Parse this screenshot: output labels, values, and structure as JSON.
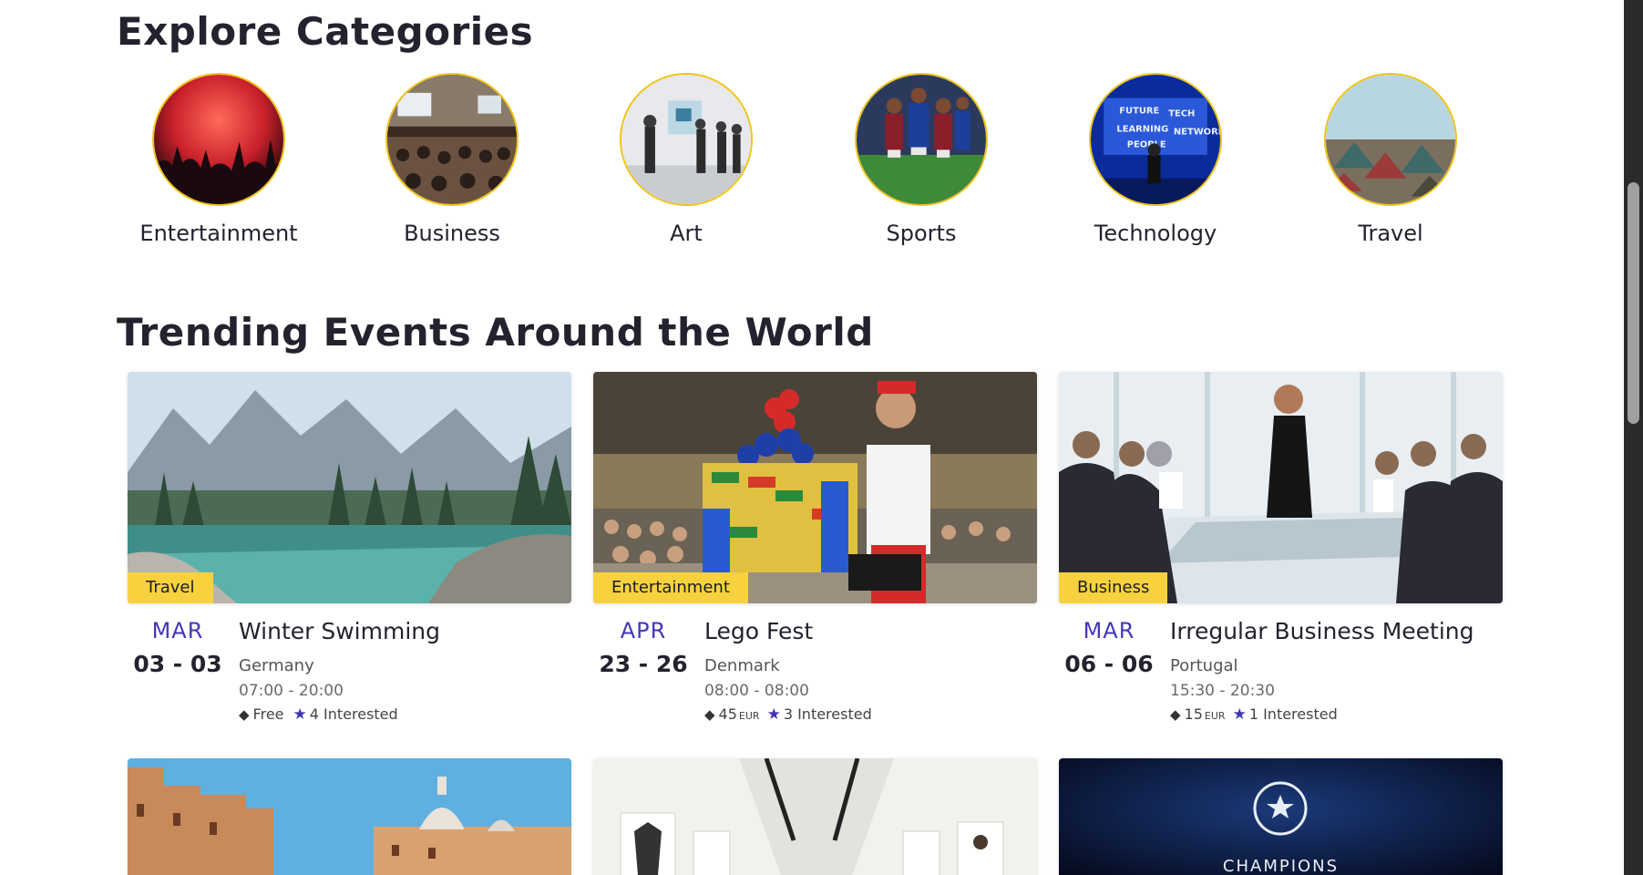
{
  "sections": {
    "categories_title": "Explore Categories",
    "trending_title": "Trending Events Around the World"
  },
  "categories": [
    {
      "label": "Entertainment",
      "icon": "concert-crowd-image"
    },
    {
      "label": "Business",
      "icon": "conference-room-image"
    },
    {
      "label": "Art",
      "icon": "art-gallery-image"
    },
    {
      "label": "Sports",
      "icon": "football-players-image"
    },
    {
      "label": "Technology",
      "icon": "tech-speaker-image"
    },
    {
      "label": "Travel",
      "icon": "camping-tents-image"
    }
  ],
  "events": [
    {
      "category": "Travel",
      "month": "MAR",
      "days": "03 - 03",
      "title": "Winter Swimming",
      "location": "Germany",
      "time": "07:00  - 20:00",
      "price": "Free",
      "currency": "",
      "interested": "4 Interested",
      "image": "alpine-lake-image"
    },
    {
      "category": "Entertainment",
      "month": "APR",
      "days": "23 - 26",
      "title": "Lego Fest",
      "location": "Denmark",
      "time": "08:00  - 08:00",
      "price": "45",
      "currency": "EUR",
      "interested": "3 Interested",
      "image": "lego-tower-image"
    },
    {
      "category": "Business",
      "month": "MAR",
      "days": "06 - 06",
      "title": "Irregular Business Meeting",
      "location": "Portugal",
      "time": "15:30  - 20:30",
      "price": "15",
      "currency": "EUR",
      "interested": "1 Interested",
      "image": "boardroom-meeting-image"
    }
  ],
  "next_row": [
    {
      "image": "venice-canal-image"
    },
    {
      "image": "gallery-hallway-image"
    },
    {
      "image": "champions-league-image",
      "text": "CHAMPIONS"
    }
  ],
  "colors": {
    "accent": "#4338b8",
    "badge": "#f7d23e",
    "circle_border": "#f0c419"
  }
}
